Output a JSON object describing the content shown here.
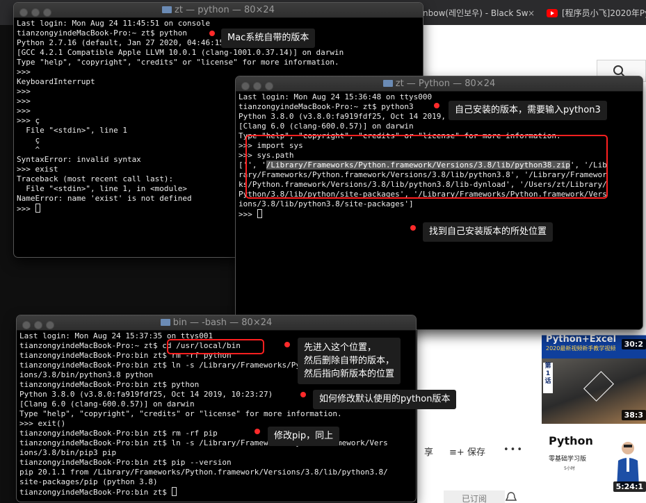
{
  "browser": {
    "tab1": "nbow(레인보우) - Black Sw",
    "tab1_close": "×",
    "tab2": "[程序员小飞]2020年Py",
    "share": "享",
    "save": "保存",
    "more": "•••",
    "subscribed": "已订阅",
    "thumbs": [
      {
        "title": "Python+Excel",
        "subtitle": "2020最新视频新手教学视频",
        "duration": "30:2"
      },
      {
        "badge": "第1话",
        "duration": "38:3"
      },
      {
        "title": "Python",
        "subtitle": "零基础学习版",
        "meta": "5小时",
        "duration": "5:24:1"
      }
    ]
  },
  "term1": {
    "title": "zt — python — 80×24",
    "lines": [
      "Last login: Mon Aug 24 11:45:51 on console",
      "tianzongyindeMacBook-Pro:~ zt$ python",
      "Python 2.7.16 (default, Jan 27 2020, 04:46:15)",
      "[GCC 4.2.1 Compatible Apple LLVM 10.0.1 (clang-1001.0.37.14)] on darwin",
      "Type \"help\", \"copyright\", \"credits\" or \"license\" for more information.",
      ">>> ",
      "KeyboardInterrupt",
      ">>> ",
      ">>> ",
      ">>> ",
      ">>> ç",
      "  File \"<stdin>\", line 1",
      "    ç",
      "    ^",
      "SyntaxError: invalid syntax",
      ">>> exist",
      "Traceback (most recent call last):",
      "  File \"<stdin>\", line 1, in <module>",
      "NameError: name 'exist' is not defined",
      ">>> "
    ]
  },
  "term2": {
    "title": "zt — Python — 80×24",
    "lines": [
      "Last login: Mon Aug 24 15:36:48 on ttys000",
      "tianzongyindeMacBook-Pro:~ zt$ python3",
      "Python 3.8.0 (v3.8.0:fa919fdf25, Oct 14 2019, 10:23:27)",
      "[Clang 6.0 (clang-600.0.57)] on darwin",
      "Type \"help\", \"copyright\", \"credits\" or \"license\" for more information.",
      ">>> import sys",
      ">>> sys.path",
      "['', '/Library/Frameworks/Python.framework/Versions/3.8/lib/python38.zip', '/Lib",
      "rary/Frameworks/Python.framework/Versions/3.8/lib/python3.8', '/Library/Framewor",
      "ks/Python.framework/Versions/3.8/lib/python3.8/lib-dynload', '/Users/zt/Library/",
      "Python/3.8/lib/python/site-packages', '/Library/Frameworks/Python.framework/Vers",
      "ions/3.8/lib/python3.8/site-packages']",
      ">>> "
    ],
    "highlight": "/Library/Frameworks/Python.framework/Versions/3.8/lib/python38.zip"
  },
  "term3": {
    "title": "bin — -bash — 80×24",
    "lines": [
      "Last login: Mon Aug 24 15:37:35 on ttys001",
      "tianzongyindeMacBook-Pro:~ zt$ cd /usr/local/bin",
      "tianzongyindeMacBook-Pro:bin zt$ rm -rf python",
      "tianzongyindeMacBook-Pro:bin zt$ ln -s /Library/Frameworks/Python.framework/Vers",
      "ions/3.8/bin/python3.8 python",
      "tianzongyindeMacBook-Pro:bin zt$ python",
      "Python 3.8.0 (v3.8.0:fa919fdf25, Oct 14 2019, 10:23:27)",
      "[Clang 6.0 (clang-600.0.57)] on darwin",
      "Type \"help\", \"copyright\", \"credits\" or \"license\" for more information.",
      ">>> exit()",
      "tianzongyindeMacBook-Pro:bin zt$ rm -rf pip",
      "tianzongyindeMacBook-Pro:bin zt$ ln -s /Library/Frameworks/Python.framework/Vers",
      "ions/3.8/bin/pip3 pip",
      "tianzongyindeMacBook-Pro:bin zt$ pip --version",
      "pip 20.1.1 from /Library/Frameworks/Python.framework/Versions/3.8/lib/python3.8/",
      "site-packages/pip (python 3.8)",
      "tianzongyindeMacBook-Pro:bin zt$ "
    ]
  },
  "annotations": {
    "mac_builtin": "Mac系统自带的版本",
    "self_installed": "自己安装的版本，需要输入python3",
    "find_location": "找到自己安装版本的所处位置",
    "steps": "先进入这个位置，\n然后删除自带的版本，\n然后指向新版本的位置",
    "change_default": "如何修改默认使用的python版本",
    "modify_pip": "修改pip，同上"
  }
}
